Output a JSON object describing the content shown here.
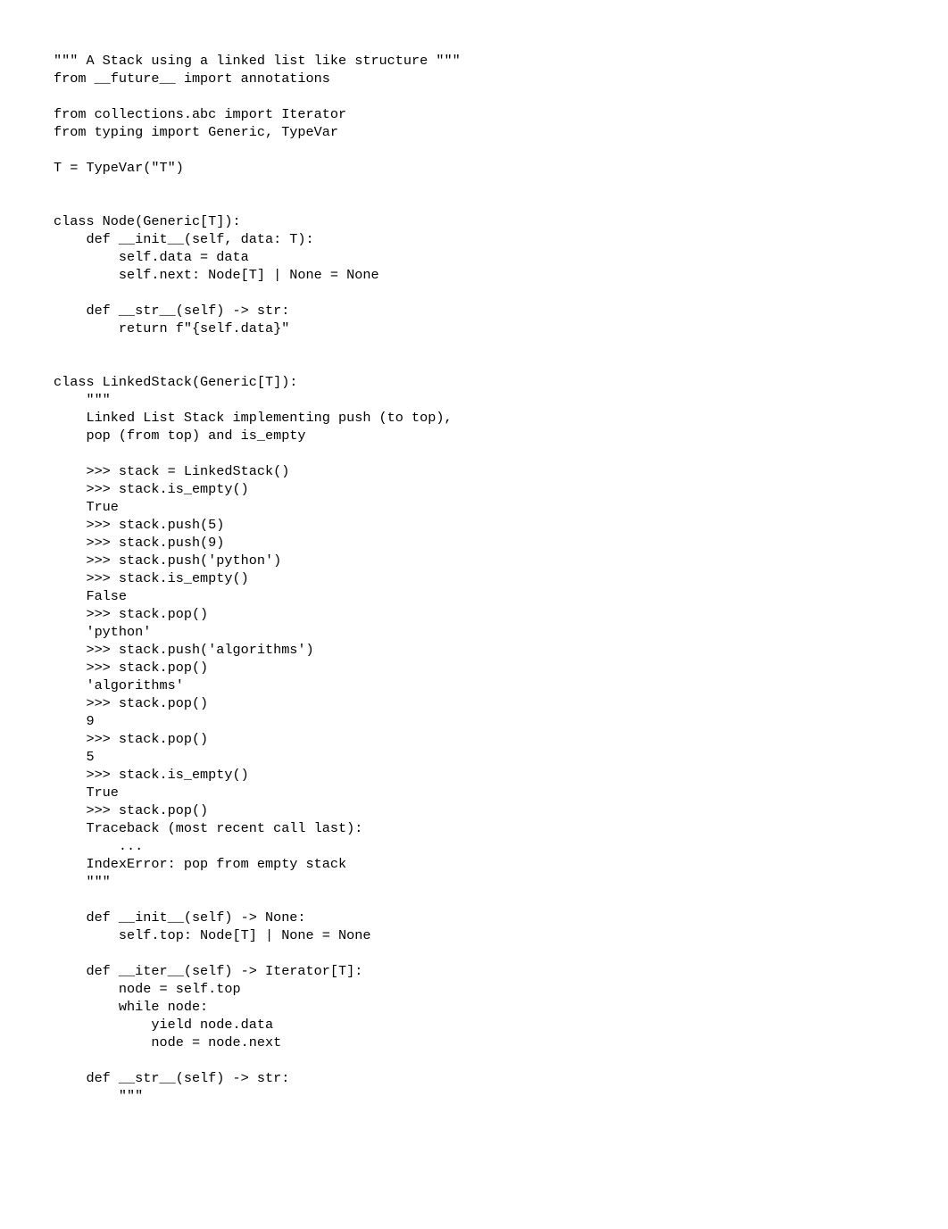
{
  "code": {
    "lines": [
      "\"\"\" A Stack using a linked list like structure \"\"\"",
      "from __future__ import annotations",
      "",
      "from collections.abc import Iterator",
      "from typing import Generic, TypeVar",
      "",
      "T = TypeVar(\"T\")",
      "",
      "",
      "class Node(Generic[T]):",
      "    def __init__(self, data: T):",
      "        self.data = data",
      "        self.next: Node[T] | None = None",
      "",
      "    def __str__(self) -> str:",
      "        return f\"{self.data}\"",
      "",
      "",
      "class LinkedStack(Generic[T]):",
      "    \"\"\"",
      "    Linked List Stack implementing push (to top),",
      "    pop (from top) and is_empty",
      "",
      "    >>> stack = LinkedStack()",
      "    >>> stack.is_empty()",
      "    True",
      "    >>> stack.push(5)",
      "    >>> stack.push(9)",
      "    >>> stack.push('python')",
      "    >>> stack.is_empty()",
      "    False",
      "    >>> stack.pop()",
      "    'python'",
      "    >>> stack.push('algorithms')",
      "    >>> stack.pop()",
      "    'algorithms'",
      "    >>> stack.pop()",
      "    9",
      "    >>> stack.pop()",
      "    5",
      "    >>> stack.is_empty()",
      "    True",
      "    >>> stack.pop()",
      "    Traceback (most recent call last):",
      "        ...",
      "    IndexError: pop from empty stack",
      "    \"\"\"",
      "",
      "    def __init__(self) -> None:",
      "        self.top: Node[T] | None = None",
      "",
      "    def __iter__(self) -> Iterator[T]:",
      "        node = self.top",
      "        while node:",
      "            yield node.data",
      "            node = node.next",
      "",
      "    def __str__(self) -> str:",
      "        \"\"\""
    ]
  }
}
